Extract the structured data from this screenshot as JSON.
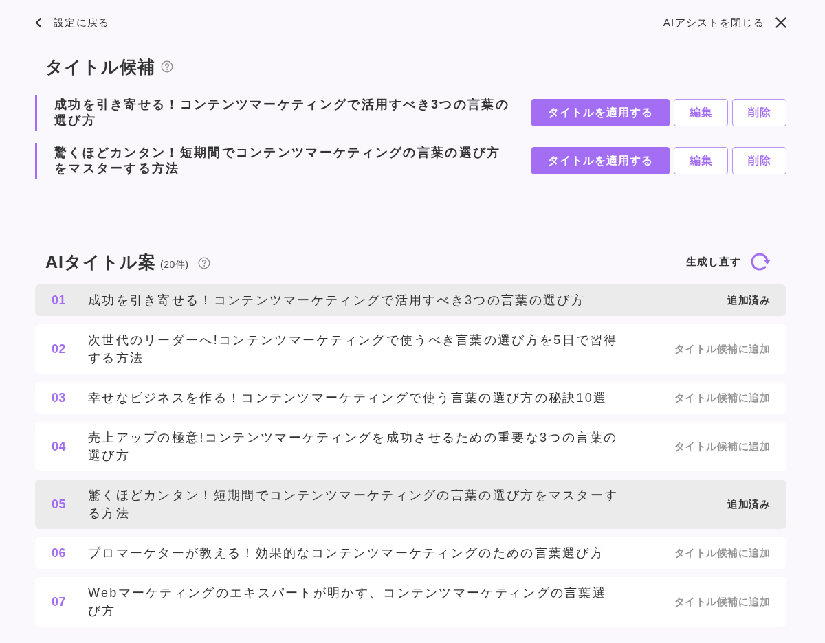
{
  "top_bar": {
    "back_link": "設定に戻る",
    "close_link": "AIアシストを閉じる"
  },
  "candidates": {
    "heading": "タイトル候補",
    "items": [
      {
        "title": "成功を引き寄せる！コンテンツマーケティングで活用すべき3つの言葉の選び方",
        "apply_button": "タイトルを適用する",
        "edit_button": "編集",
        "delete_button": "削除"
      },
      {
        "title": "驚くほどカンタン！短期間でコンテンツマーケティングの言葉の選び方をマスターする方法",
        "apply_button": "タイトルを適用する",
        "edit_button": "編集",
        "delete_button": "削除"
      }
    ]
  },
  "ai_titles": {
    "heading": "AIタイトル案",
    "count": "(20件)",
    "regenerate_button": "生成し直す",
    "items": [
      {
        "number": "01",
        "title": "成功を引き寄せる！コンテンツマーケティングで活用すべき3つの言葉の選び方",
        "added": true,
        "action": "追加済み"
      },
      {
        "number": "02",
        "title": "次世代のリーダーへ!コンテンツマーケティングで使うべき言葉の選び方を5日で習得する方法",
        "added": false,
        "action": "タイトル候補に追加"
      },
      {
        "number": "03",
        "title": "幸せなビジネスを作る！コンテンツマーケティングで使う言葉の選び方の秘訣10選",
        "added": false,
        "action": "タイトル候補に追加"
      },
      {
        "number": "04",
        "title": "売上アップの極意!コンテンツマーケティングを成功させるための重要な3つの言葉の選び方",
        "added": false,
        "action": "タイトル候補に追加"
      },
      {
        "number": "05",
        "title": "驚くほどカンタン！短期間でコンテンツマーケティングの言葉の選び方をマスターする方法",
        "added": true,
        "action": "追加済み"
      },
      {
        "number": "06",
        "title": "プロマーケターが教える！効果的なコンテンツマーケティングのための言葉選び方",
        "added": false,
        "action": "タイトル候補に追加"
      },
      {
        "number": "07",
        "title": "Webマーケティングのエキスパートが明かす、コンテンツマーケティングの言葉選び方",
        "added": false,
        "action": "タイトル候補に追加"
      }
    ]
  }
}
